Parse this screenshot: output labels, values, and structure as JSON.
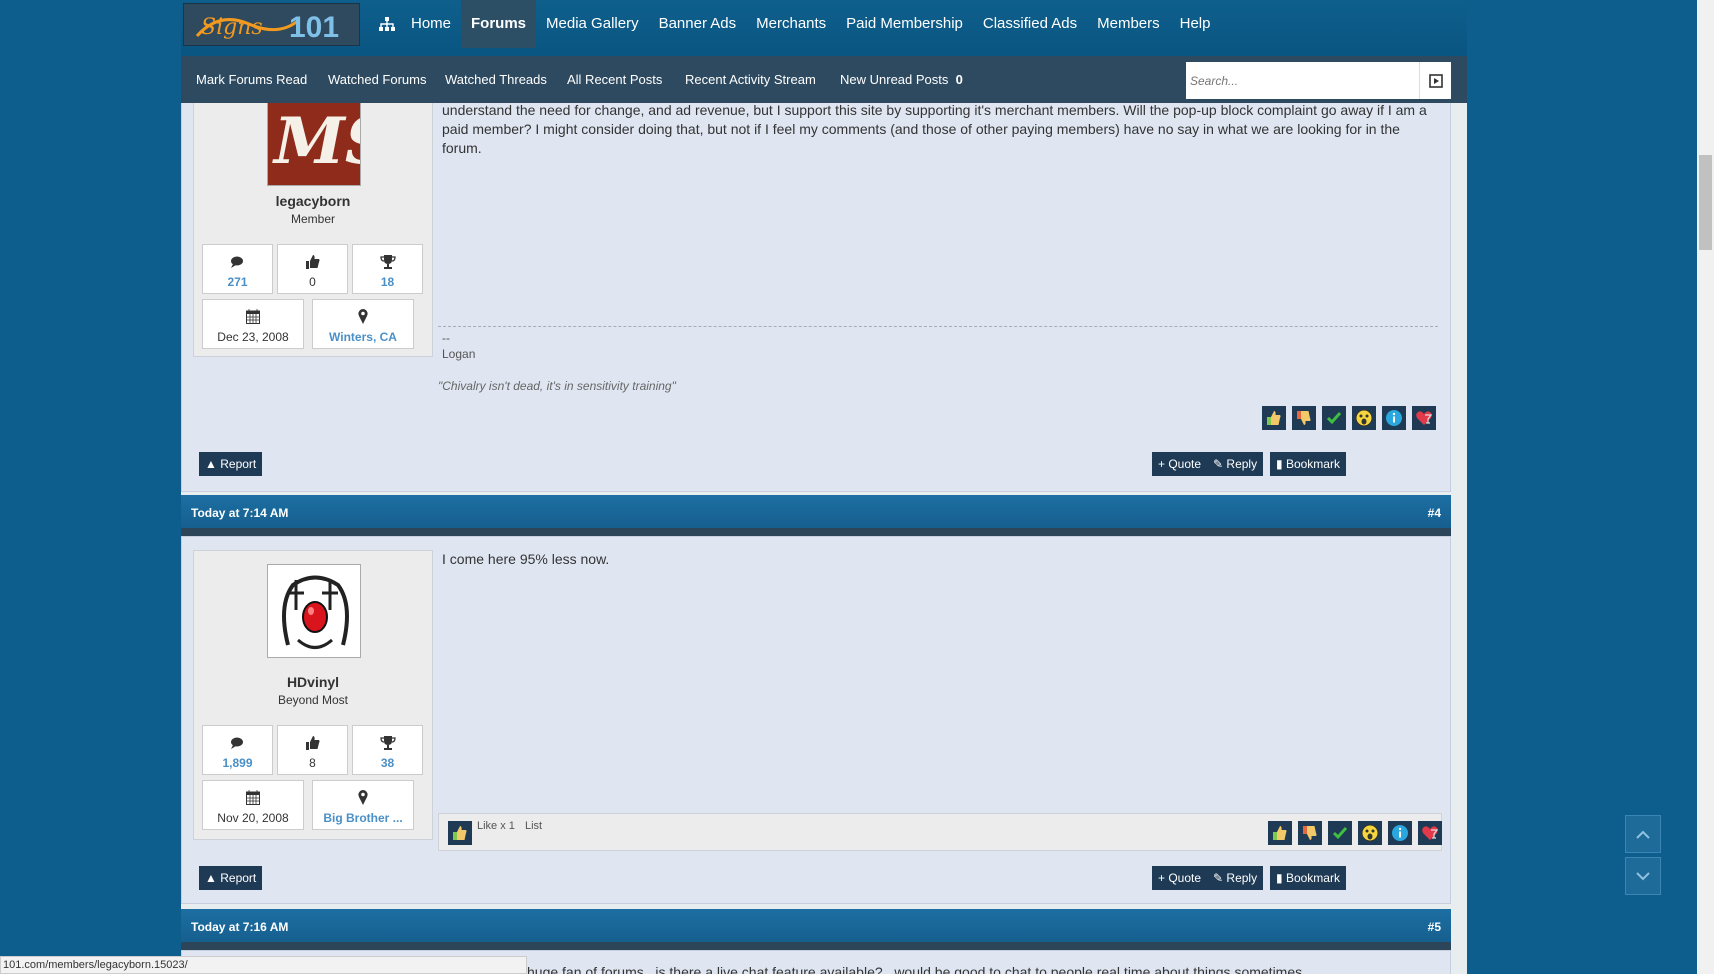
{
  "colors": {
    "brand": "#0d5e8c",
    "nav_dark": "#2e4a60",
    "button": "#1f3a55",
    "link": "#4a90c7"
  },
  "logo": {
    "text": "Signs101"
  },
  "nav": {
    "items": [
      {
        "label": "Home"
      },
      {
        "label": "Forums"
      },
      {
        "label": "Media Gallery"
      },
      {
        "label": "Banner Ads"
      },
      {
        "label": "Merchants"
      },
      {
        "label": "Paid Membership"
      },
      {
        "label": "Classified Ads"
      },
      {
        "label": "Members"
      },
      {
        "label": "Help"
      }
    ],
    "active": "Forums"
  },
  "subnav": {
    "items": [
      {
        "label": "Mark Forums Read"
      },
      {
        "label": "Watched Forums"
      },
      {
        "label": "Watched Threads"
      },
      {
        "label": "All Recent Posts"
      },
      {
        "label": "Recent Activity Stream"
      },
      {
        "label": "New Unread Posts"
      }
    ],
    "unread_count": "0",
    "search_placeholder": "Search..."
  },
  "posts": [
    {
      "username": "legacyborn",
      "title": "Member",
      "stats": {
        "messages": "271",
        "likes": "0",
        "trophies": "18"
      },
      "joined": "Dec 23, 2008",
      "location": "Winters, CA",
      "text": "understand the need for change, and ad revenue, but I support this site by supporting it's merchant members. Will the pop-up block complaint go away if I am a paid member? I might consider doing that, but not if I feel my comments (and those of other paying members) have no say in what we are looking for in the forum.",
      "signature_dash": "--",
      "signature_name": "Logan",
      "signature_quote": "\"Chivalry isn't dead, it's in sensitivity training\"",
      "report": "Report",
      "quote": "+ Quote",
      "reply": "Reply",
      "bookmark": "Bookmark"
    },
    {
      "timestamp": "Today at 7:14 AM",
      "number": "#4",
      "username": "HDvinyl",
      "title": "Beyond Most",
      "stats": {
        "messages": "1,899",
        "likes": "8",
        "trophies": "38"
      },
      "joined": "Nov 20, 2008",
      "location": "Big Brother ...",
      "text": "I come here 95% less now.",
      "like_summary": "Like x 1",
      "like_list": "List",
      "report": "Report",
      "quote": "+ Quote",
      "reply": "Reply",
      "bookmark": "Bookmark"
    },
    {
      "timestamp": "Today at 7:16 AM",
      "number": "#5",
      "text_partial": "huge fan of forums.. is there a live chat feature available?.. would be good to chat to people real time about things sometimes"
    }
  ],
  "statusbar": {
    "url": "101.com/members/legacyborn.15023/"
  }
}
